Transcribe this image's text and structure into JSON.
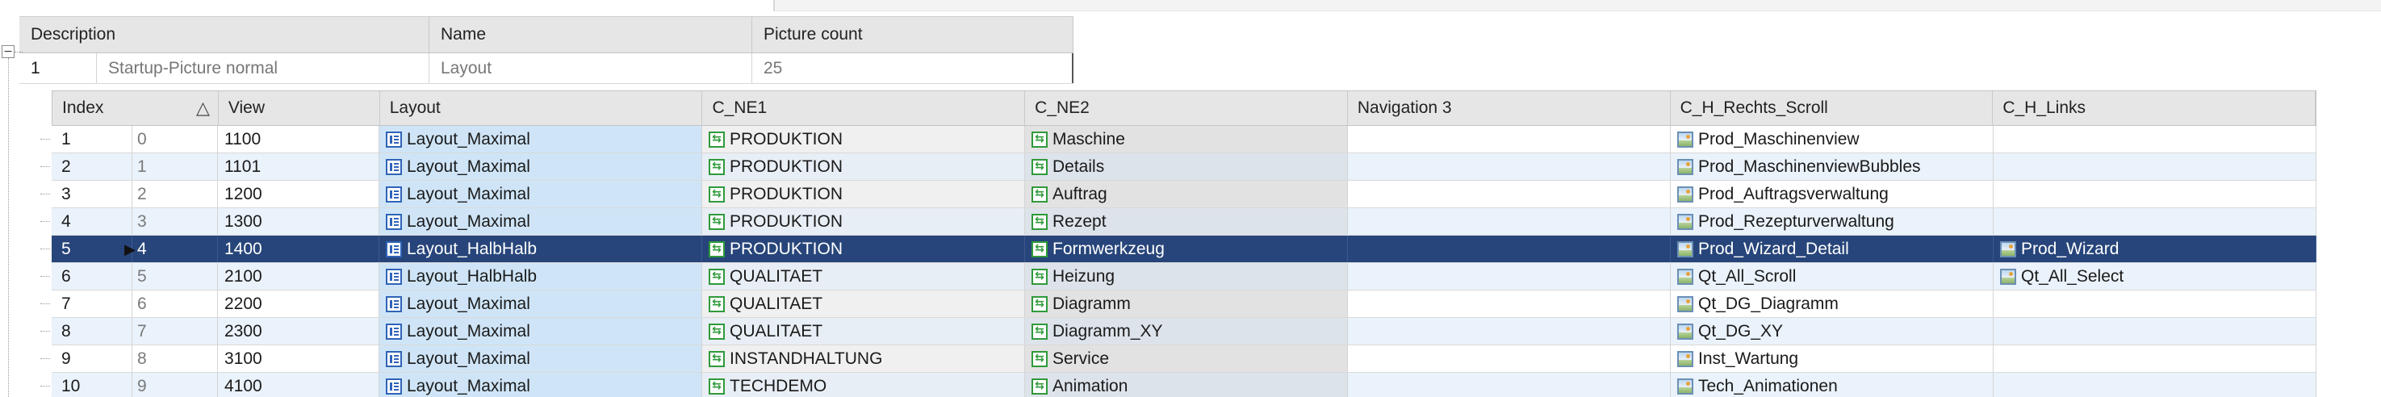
{
  "master": {
    "columns": [
      "Description",
      "Name",
      "Picture count"
    ],
    "row": {
      "expander": "−",
      "index": "1",
      "description": "Startup-Picture normal",
      "name": "Layout",
      "picture_count": "25"
    }
  },
  "detail": {
    "columns": [
      "Index",
      "View",
      "Layout",
      "C_NE1",
      "C_NE2",
      "Navigation 3",
      "C_H_Rechts_Scroll",
      "C_H_Links"
    ],
    "sort_indicator": "△",
    "selected_pointer": "▶",
    "rows": [
      {
        "index": "1",
        "key": "0",
        "view": "1100",
        "layout": "Layout_Maximal",
        "ne1": "PRODUKTION",
        "ne2": "Maschine",
        "nav3": "",
        "rechts": "Prod_Maschinenview",
        "links": ""
      },
      {
        "index": "2",
        "key": "1",
        "view": "1101",
        "layout": "Layout_Maximal",
        "ne1": "PRODUKTION",
        "ne2": "Details",
        "nav3": "",
        "rechts": "Prod_MaschinenviewBubbles",
        "links": ""
      },
      {
        "index": "3",
        "key": "2",
        "view": "1200",
        "layout": "Layout_Maximal",
        "ne1": "PRODUKTION",
        "ne2": "Auftrag",
        "nav3": "",
        "rechts": "Prod_Auftragsverwaltung",
        "links": ""
      },
      {
        "index": "4",
        "key": "3",
        "view": "1300",
        "layout": "Layout_Maximal",
        "ne1": "PRODUKTION",
        "ne2": "Rezept",
        "nav3": "",
        "rechts": "Prod_Rezepturverwaltung",
        "links": ""
      },
      {
        "index": "5",
        "key": "4",
        "view": "1400",
        "layout": "Layout_HalbHalb",
        "ne1": "PRODUKTION",
        "ne2": "Formwerkzeug",
        "nav3": "",
        "rechts": "Prod_Wizard_Detail",
        "links": "Prod_Wizard",
        "selected": true
      },
      {
        "index": "6",
        "key": "5",
        "view": "2100",
        "layout": "Layout_HalbHalb",
        "ne1": "QUALITAET",
        "ne2": "Heizung",
        "nav3": "",
        "rechts": "Qt_All_Scroll",
        "links": "Qt_All_Select"
      },
      {
        "index": "7",
        "key": "6",
        "view": "2200",
        "layout": "Layout_Maximal",
        "ne1": "QUALITAET",
        "ne2": "Diagramm",
        "nav3": "",
        "rechts": "Qt_DG_Diagramm",
        "links": ""
      },
      {
        "index": "8",
        "key": "7",
        "view": "2300",
        "layout": "Layout_Maximal",
        "ne1": "QUALITAET",
        "ne2": "Diagramm_XY",
        "nav3": "",
        "rechts": "Qt_DG_XY",
        "links": ""
      },
      {
        "index": "9",
        "key": "8",
        "view": "3100",
        "layout": "Layout_Maximal",
        "ne1": "INSTANDHALTUNG",
        "ne2": "Service",
        "nav3": "",
        "rechts": "Inst_Wartung",
        "links": ""
      },
      {
        "index": "10",
        "key": "9",
        "view": "4100",
        "layout": "Layout_Maximal",
        "ne1": "TECHDEMO",
        "ne2": "Animation",
        "nav3": "",
        "rechts": "Tech_Animationen",
        "links": ""
      }
    ]
  },
  "icons": {
    "layout": "layout-icon",
    "navigation": "navigation-icon",
    "picture": "picture-icon"
  },
  "colors": {
    "selection": "#27457a",
    "header": "#e6e6e6",
    "alt_row": "#eaf2fb",
    "layout_cell": "#cfe5f7"
  }
}
